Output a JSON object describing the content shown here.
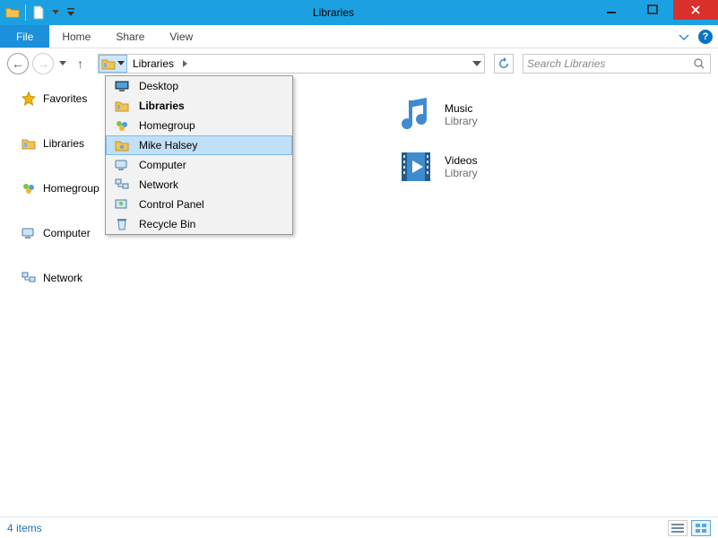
{
  "window": {
    "title": "Libraries"
  },
  "ribbon": {
    "file": "File",
    "tabs": [
      "Home",
      "Share",
      "View"
    ],
    "expand_tip": "v"
  },
  "address": {
    "crumbs": [
      "Libraries"
    ],
    "dropdown": [
      {
        "icon": "monitor",
        "label": "Desktop",
        "bold": false,
        "selected": false
      },
      {
        "icon": "libraries",
        "label": "Libraries",
        "bold": true,
        "selected": false
      },
      {
        "icon": "homegroup",
        "label": "Homegroup",
        "bold": false,
        "selected": false
      },
      {
        "icon": "user",
        "label": "Mike Halsey",
        "bold": false,
        "selected": true
      },
      {
        "icon": "computer",
        "label": "Computer",
        "bold": false,
        "selected": false
      },
      {
        "icon": "network",
        "label": "Network",
        "bold": false,
        "selected": false
      },
      {
        "icon": "cpanel",
        "label": "Control Panel",
        "bold": false,
        "selected": false
      },
      {
        "icon": "recycle",
        "label": "Recycle Bin",
        "bold": false,
        "selected": false
      }
    ]
  },
  "search": {
    "placeholder": "Search Libraries"
  },
  "sidebar": {
    "items": [
      {
        "icon": "star",
        "label": "Favorites"
      },
      {
        "icon": "libraries",
        "label": "Libraries"
      },
      {
        "icon": "homegroup",
        "label": "Homegroup"
      },
      {
        "icon": "computer",
        "label": "Computer"
      },
      {
        "icon": "network",
        "label": "Network"
      }
    ]
  },
  "content": {
    "items": [
      {
        "icon": "music",
        "name": "Music",
        "sub": "Library"
      },
      {
        "icon": "videos",
        "name": "Videos",
        "sub": "Library"
      }
    ]
  },
  "status": {
    "count_text": "4 items"
  }
}
